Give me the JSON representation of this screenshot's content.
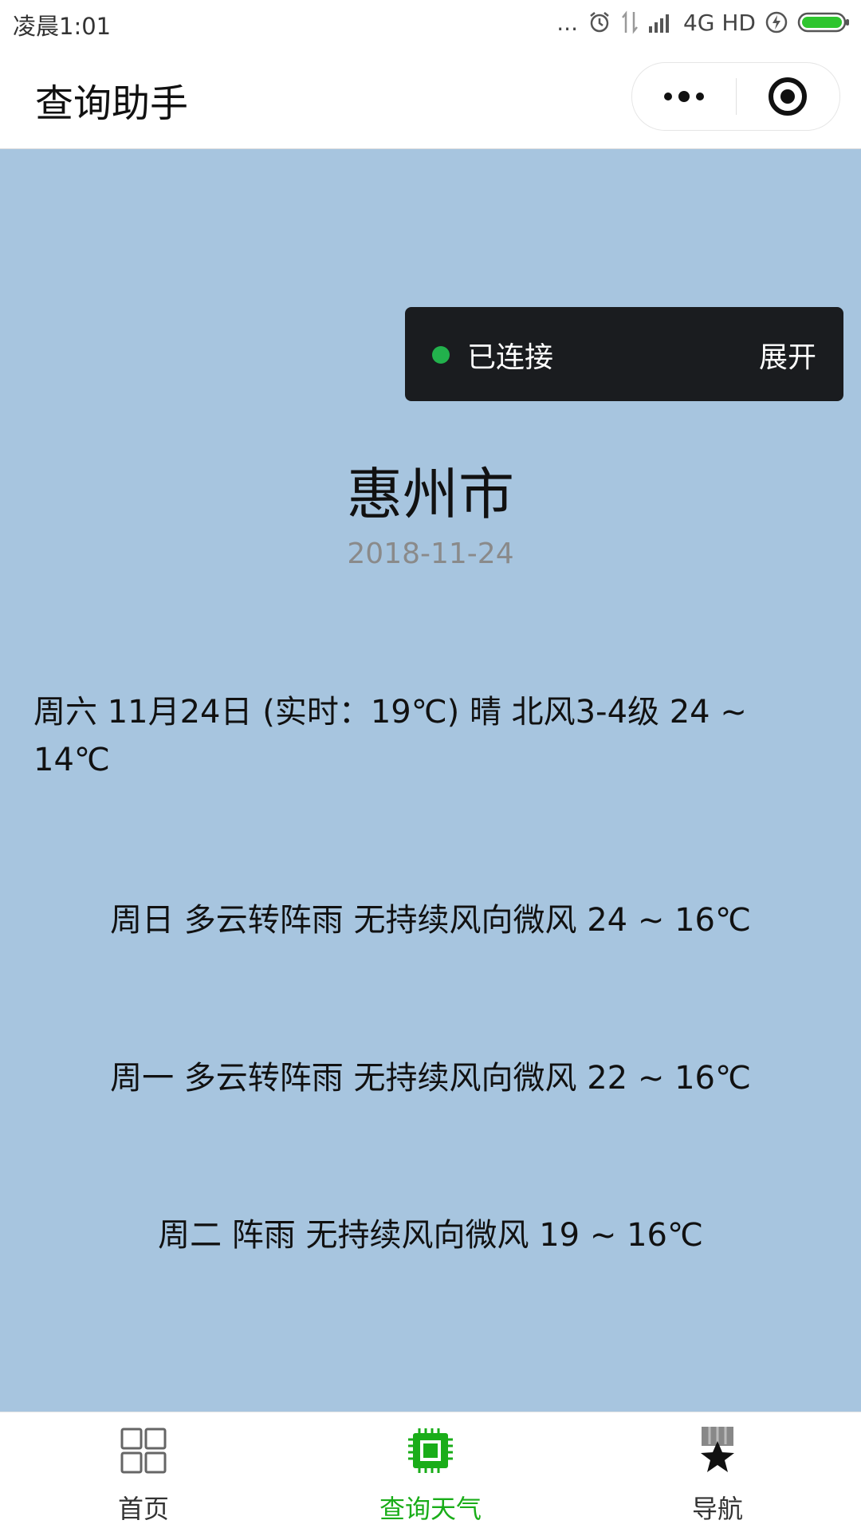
{
  "status_bar": {
    "time": "凌晨1:01",
    "dots": "...",
    "network": "4G HD"
  },
  "nav": {
    "title": "查询助手",
    "menu_icon": "more-dots-icon",
    "close_icon": "target-circle-icon"
  },
  "connection": {
    "status": "已连接",
    "expand_label": "展开",
    "status_color": "#22b14c"
  },
  "weather": {
    "city": "惠州市",
    "date": "2018-11-24",
    "today": "周六 11月24日 (实时：19℃) 晴 北风3-4级 24 ~ 14℃",
    "forecast": [
      "周日 多云转阵雨 无持续风向微风 24 ~ 16℃",
      "周一 多云转阵雨 无持续风向微风 22 ~ 16℃",
      "周二 阵雨 无持续风向微风 19 ~ 16℃"
    ]
  },
  "tabs": [
    {
      "label": "首页",
      "icon": "grid-icon",
      "active": false
    },
    {
      "label": "查询天气",
      "icon": "chip-icon",
      "active": true
    },
    {
      "label": "导航",
      "icon": "star-medal-icon",
      "active": false
    }
  ],
  "colors": {
    "background": "#a7c5df",
    "accent": "#1aad19"
  }
}
